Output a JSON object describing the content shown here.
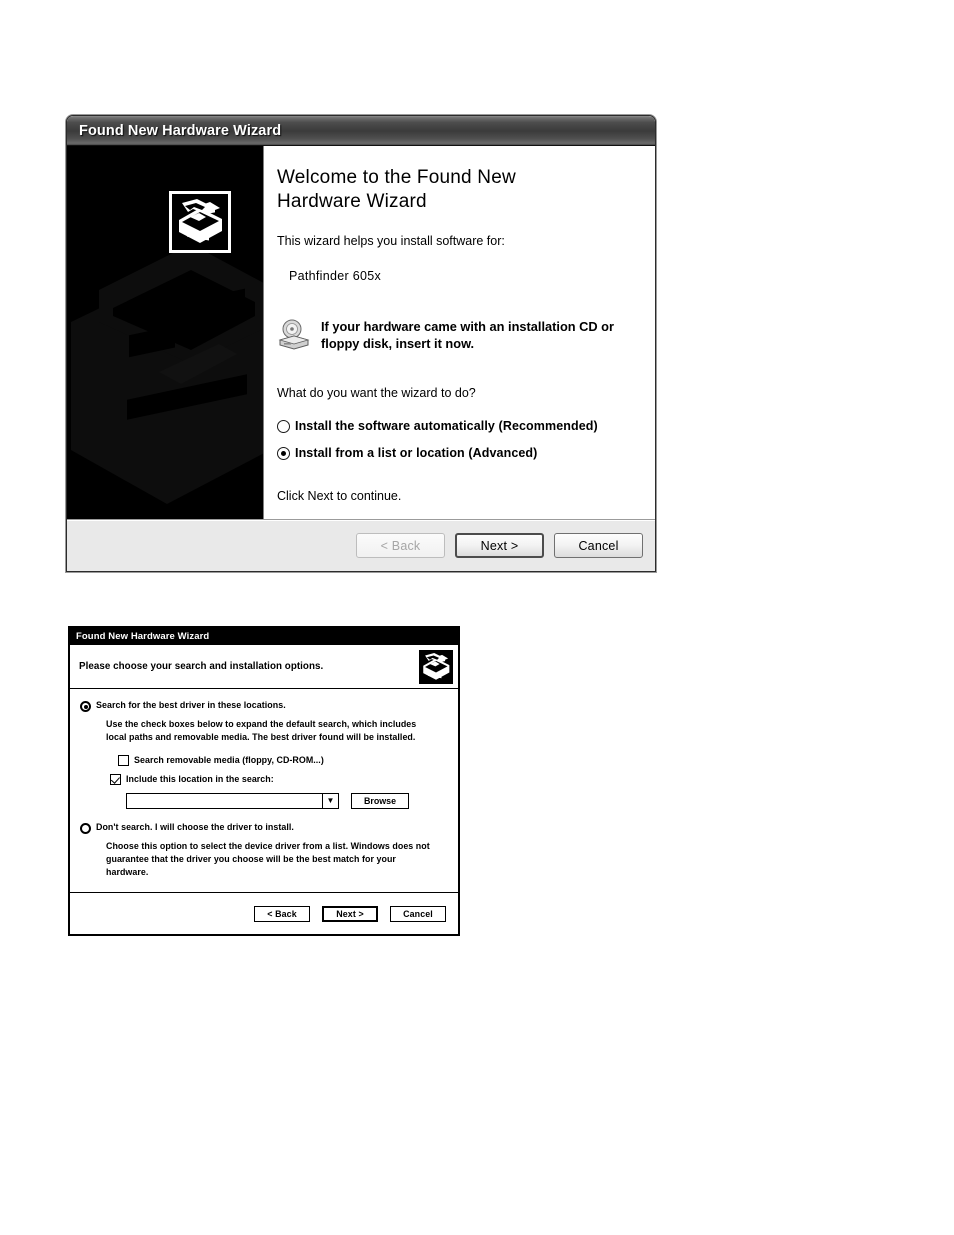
{
  "dialog1": {
    "title": "Found New Hardware Wizard",
    "heading": "Welcome to the Found New Hardware Wizard",
    "intro": "This wizard helps you install software for:",
    "device_name": "Pathfinder 605x",
    "cd_notice": "If your hardware came with an installation CD or floppy disk, insert it now.",
    "question": "What do you want the wizard to do?",
    "options": [
      {
        "label": "Install the software automatically (Recommended)",
        "selected": false
      },
      {
        "label": "Install from a list or location (Advanced)",
        "selected": true
      }
    ],
    "footer_hint": "Click Next to continue.",
    "buttons": [
      {
        "label": "< Back",
        "state": "disabled"
      },
      {
        "label": "Next >",
        "state": "default"
      },
      {
        "label": "Cancel",
        "state": "normal"
      }
    ],
    "icons": {
      "hardware": "hardware-wizard-icon",
      "media": "cd-drive-icon"
    }
  },
  "dialog2": {
    "title": "Found New Hardware Wizard",
    "header": "Please choose your search and installation options.",
    "option1": {
      "label": "Search for the best driver in these locations.",
      "selected": true,
      "description": "Use the check boxes below to expand the default search, which includes local paths and removable media. The best driver found will be installed.",
      "checkboxes": [
        {
          "label": "Search removable media (floppy, CD-ROM...)",
          "checked": false
        },
        {
          "label": "Include this location in the search:",
          "checked": true
        }
      ],
      "location_value": "",
      "browse_label": "Browse"
    },
    "option2": {
      "label": "Don't search. I will choose the driver to install.",
      "selected": false,
      "description": "Choose this option to select the device driver from a list. Windows does not guarantee that the driver you choose will be the best match for your hardware."
    },
    "buttons": [
      {
        "label": "< Back",
        "state": "normal"
      },
      {
        "label": "Next >",
        "state": "default"
      },
      {
        "label": "Cancel",
        "state": "normal"
      }
    ],
    "icons": {
      "hardware": "hardware-wizard-icon"
    }
  },
  "colors": {
    "titlebar_dark": "#3b3b3b",
    "sidepanel": "#000000",
    "footer_bar": "#e9e9e9",
    "text": "#000000"
  }
}
